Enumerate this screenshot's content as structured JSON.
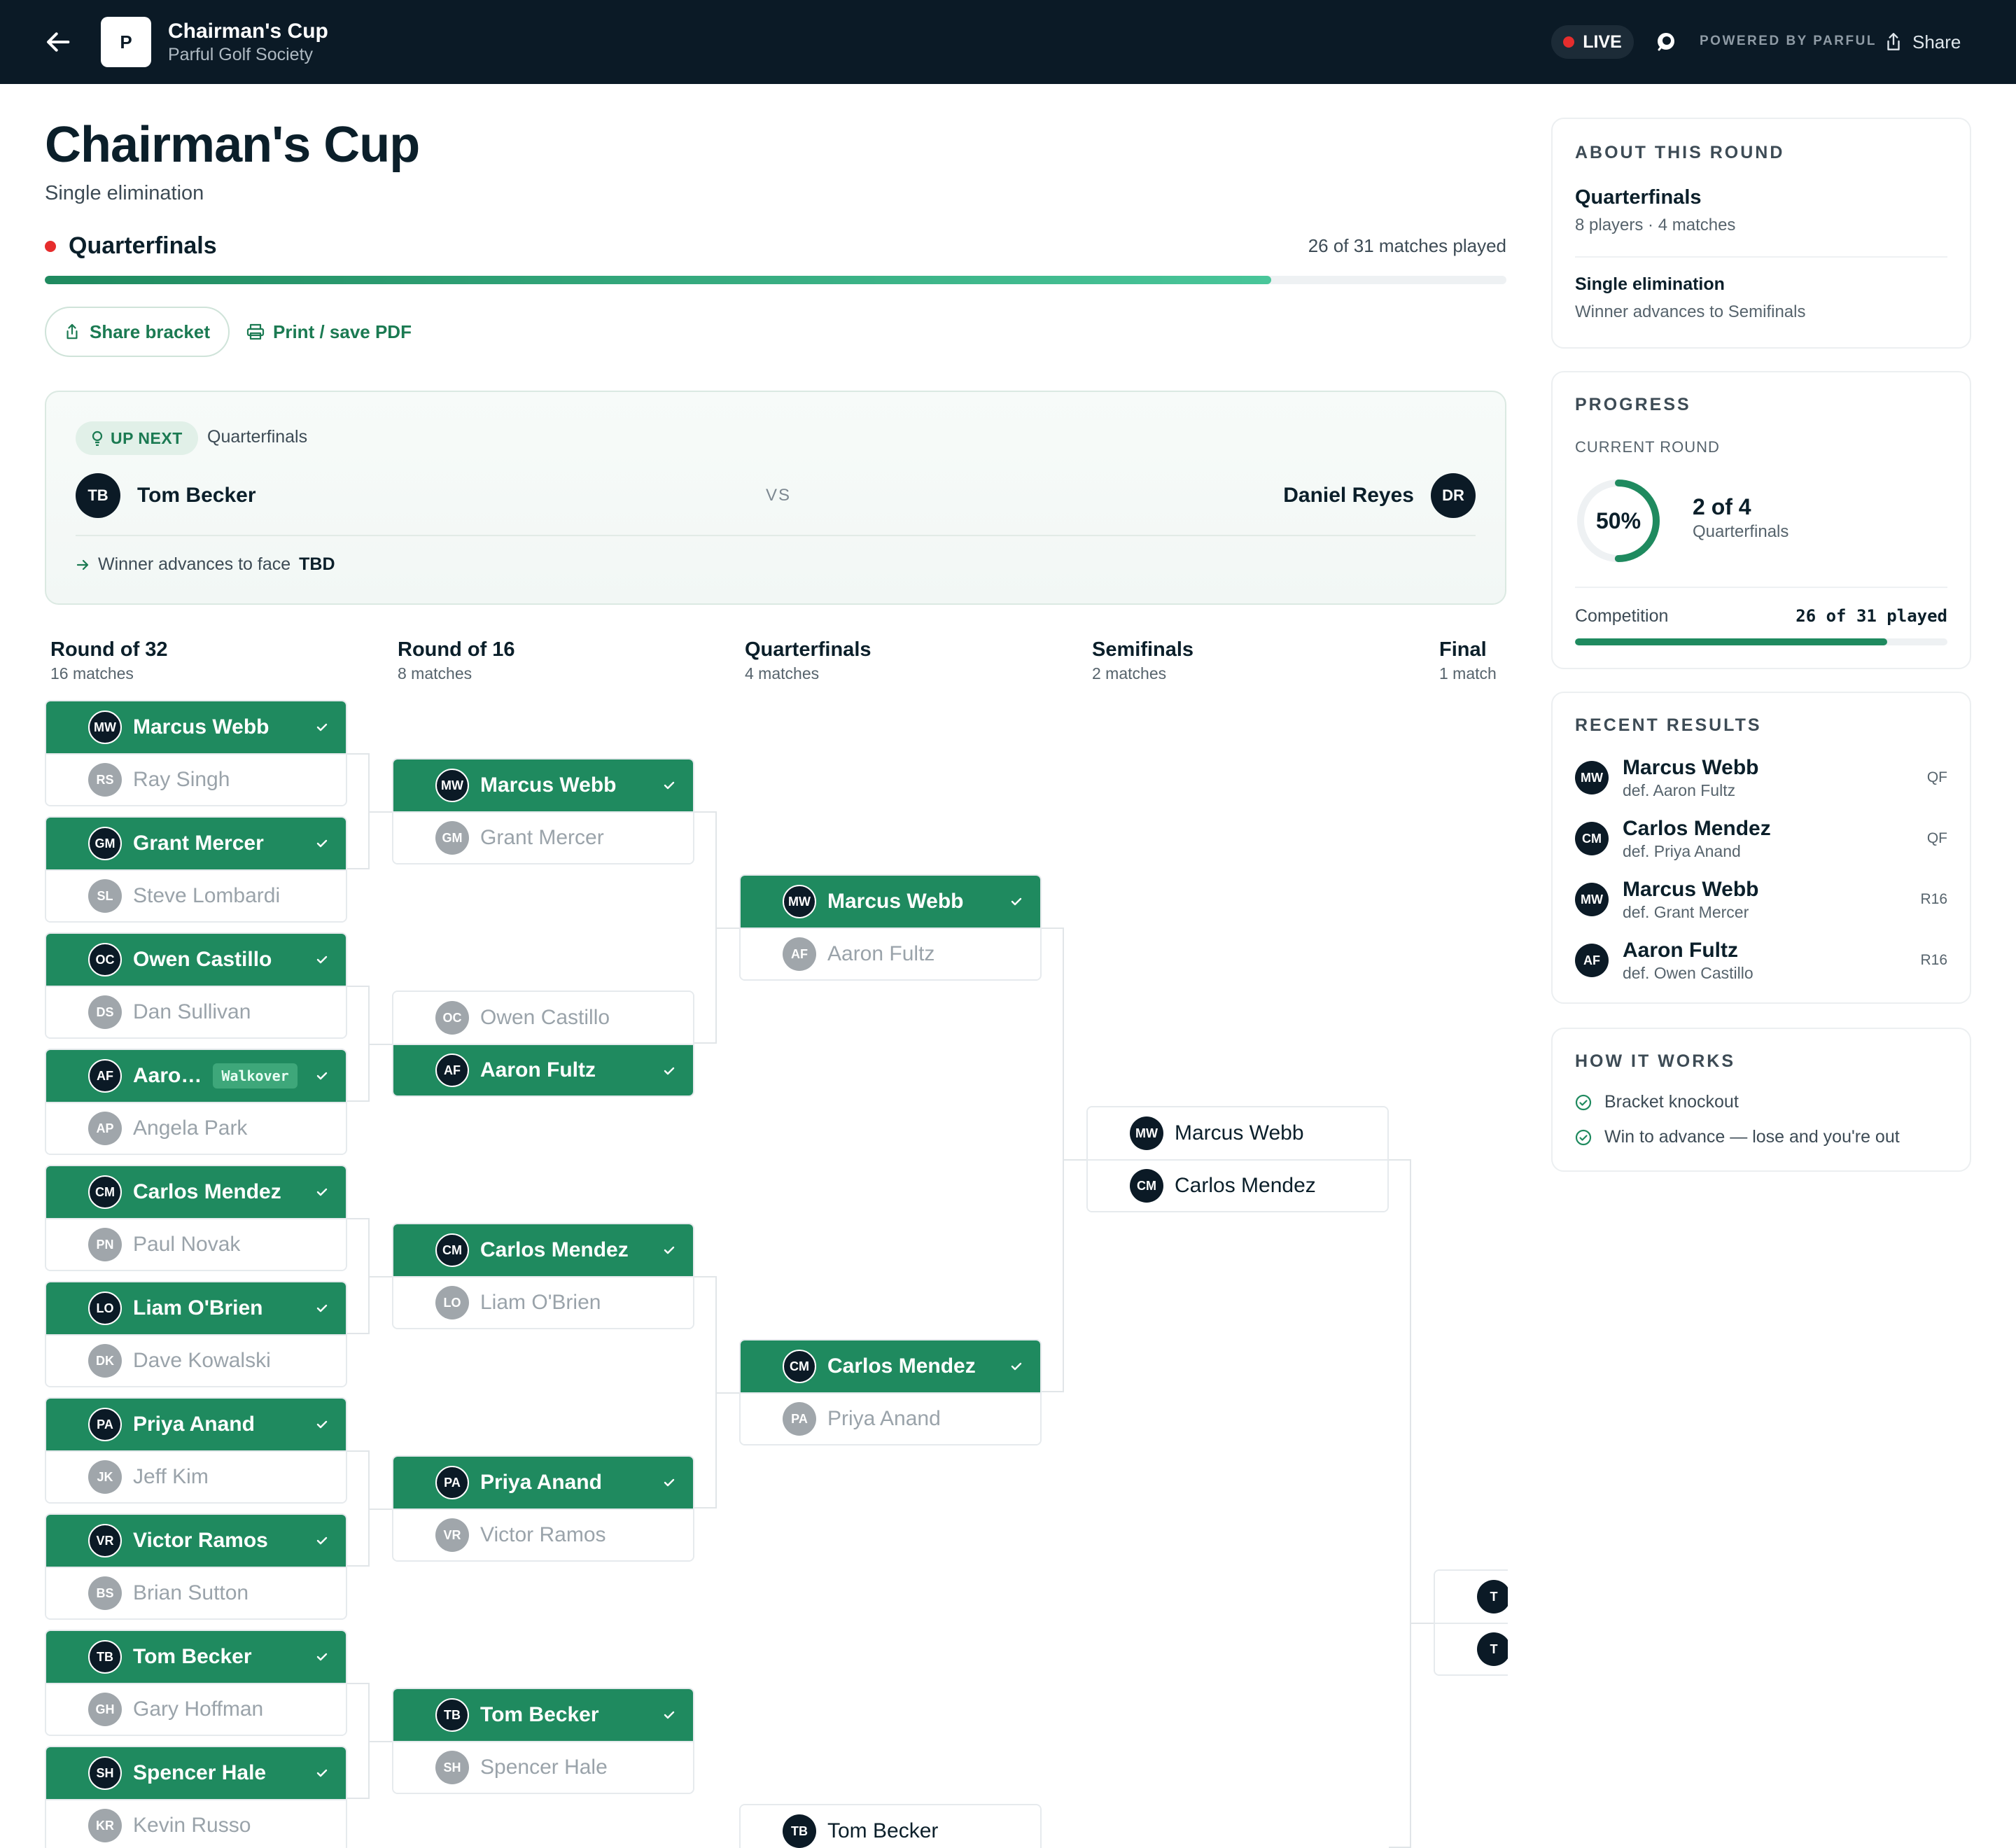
{
  "topbar": {
    "title": "Chairman's Cup",
    "subtitle": "Parful Golf Society",
    "logo_letter": "P",
    "live_label": "LIVE",
    "powered_by": "POWERED BY PARFUL",
    "share_label": "Share"
  },
  "header": {
    "title": "Chairman's Cup",
    "format": "Single elimination",
    "current_round": "Quarterfinals",
    "matches_played": "26 of 31 matches played",
    "progress_fraction": 0.839,
    "share_bracket_label": "Share bracket",
    "print_label": "Print / save PDF"
  },
  "up_next": {
    "badge": "UP NEXT",
    "round": "Quarterfinals",
    "p1": {
      "initials": "TB",
      "name": "Tom Becker"
    },
    "vs": "VS",
    "p2": {
      "initials": "DR",
      "name": "Daniel Reyes"
    },
    "advance_text": "Winner advances to face",
    "advance_target": "TBD"
  },
  "rounds": [
    {
      "title": "Round of 32",
      "sub": "16 matches"
    },
    {
      "title": "Round of 16",
      "sub": "8 matches"
    },
    {
      "title": "Quarterfinals",
      "sub": "4 matches"
    },
    {
      "title": "Semifinals",
      "sub": "2 matches"
    },
    {
      "title": "Final",
      "sub": "1 match"
    }
  ],
  "r32": [
    [
      {
        "i": "MW",
        "n": "Marcus Webb",
        "s": "win"
      },
      {
        "i": "RS",
        "n": "Ray Singh",
        "s": "lose"
      }
    ],
    [
      {
        "i": "GM",
        "n": "Grant Mercer",
        "s": "win"
      },
      {
        "i": "SL",
        "n": "Steve Lombardi",
        "s": "lose"
      }
    ],
    [
      {
        "i": "OC",
        "n": "Owen Castillo",
        "s": "win"
      },
      {
        "i": "DS",
        "n": "Dan Sullivan",
        "s": "lose"
      }
    ],
    [
      {
        "i": "AF",
        "n": "Aaro…",
        "s": "win",
        "tag": "Walkover"
      },
      {
        "i": "AP",
        "n": "Angela Park",
        "s": "lose"
      }
    ],
    [
      {
        "i": "CM",
        "n": "Carlos Mendez",
        "s": "win"
      },
      {
        "i": "PN",
        "n": "Paul Novak",
        "s": "lose"
      }
    ],
    [
      {
        "i": "LO",
        "n": "Liam O'Brien",
        "s": "win"
      },
      {
        "i": "DK",
        "n": "Dave Kowalski",
        "s": "lose"
      }
    ],
    [
      {
        "i": "PA",
        "n": "Priya Anand",
        "s": "win"
      },
      {
        "i": "JK",
        "n": "Jeff Kim",
        "s": "lose"
      }
    ],
    [
      {
        "i": "VR",
        "n": "Victor Ramos",
        "s": "win"
      },
      {
        "i": "BS",
        "n": "Brian Sutton",
        "s": "lose"
      }
    ],
    [
      {
        "i": "TB",
        "n": "Tom Becker",
        "s": "win"
      },
      {
        "i": "GH",
        "n": "Gary Hoffman",
        "s": "lose"
      }
    ],
    [
      {
        "i": "SH",
        "n": "Spencer Hale",
        "s": "win"
      },
      {
        "i": "KR",
        "n": "Kevin Russo",
        "s": "lose"
      }
    ]
  ],
  "r16": [
    [
      {
        "i": "MW",
        "n": "Marcus Webb",
        "s": "win"
      },
      {
        "i": "GM",
        "n": "Grant Mercer",
        "s": "lose"
      }
    ],
    [
      {
        "i": "OC",
        "n": "Owen Castillo",
        "s": "lose"
      },
      {
        "i": "AF",
        "n": "Aaron Fultz",
        "s": "win"
      }
    ],
    [
      {
        "i": "CM",
        "n": "Carlos Mendez",
        "s": "win"
      },
      {
        "i": "LO",
        "n": "Liam O'Brien",
        "s": "lose"
      }
    ],
    [
      {
        "i": "PA",
        "n": "Priya Anand",
        "s": "win"
      },
      {
        "i": "VR",
        "n": "Victor Ramos",
        "s": "lose"
      }
    ],
    [
      {
        "i": "TB",
        "n": "Tom Becker",
        "s": "win"
      },
      {
        "i": "SH",
        "n": "Spencer Hale",
        "s": "lose"
      }
    ]
  ],
  "qf": [
    [
      {
        "i": "MW",
        "n": "Marcus Webb",
        "s": "win"
      },
      {
        "i": "AF",
        "n": "Aaron Fultz",
        "s": "lose"
      }
    ],
    [
      {
        "i": "CM",
        "n": "Carlos Mendez",
        "s": "win"
      },
      {
        "i": "PA",
        "n": "Priya Anand",
        "s": "lose"
      }
    ],
    [
      {
        "i": "TB",
        "n": "Tom Becker",
        "s": "neutral"
      }
    ]
  ],
  "sf": [
    [
      {
        "i": "MW",
        "n": "Marcus Webb",
        "s": "neutral"
      },
      {
        "i": "CM",
        "n": "Carlos Mendez",
        "s": "neutral"
      }
    ]
  ],
  "final": [
    [
      {
        "i": "T",
        "n": "",
        "s": "neutral"
      },
      {
        "i": "T",
        "n": "",
        "s": "neutral"
      }
    ]
  ],
  "about": {
    "heading": "ABOUT THIS ROUND",
    "round": "Quarterfinals",
    "round_detail": "8 players · 4 matches",
    "format": "Single elimination",
    "format_detail": "Winner advances to Semifinals"
  },
  "progress": {
    "heading": "PROGRESS",
    "current_label": "CURRENT ROUND",
    "percent_text": "50%",
    "percent_value": 0.5,
    "count": "2 of 4",
    "round": "Quarterfinals",
    "competition_label": "Competition",
    "competition_value": "26 of 31 played",
    "competition_fraction": 0.839
  },
  "recent": {
    "heading": "RECENT RESULTS",
    "items": [
      {
        "i": "MW",
        "name": "Marcus Webb",
        "def": "def. Aaron Fultz",
        "tag": "QF"
      },
      {
        "i": "CM",
        "name": "Carlos Mendez",
        "def": "def. Priya Anand",
        "tag": "QF"
      },
      {
        "i": "MW",
        "name": "Marcus Webb",
        "def": "def. Grant Mercer",
        "tag": "R16"
      },
      {
        "i": "AF",
        "name": "Aaron Fultz",
        "def": "def. Owen Castillo",
        "tag": "R16"
      }
    ]
  },
  "how": {
    "heading": "HOW IT WORKS",
    "items": [
      "Bracket knockout",
      "Win to advance — lose and you're out"
    ]
  },
  "colors": {
    "accent": "#1f8a5f",
    "live": "#e62d2d",
    "navy": "#0b1a26"
  }
}
